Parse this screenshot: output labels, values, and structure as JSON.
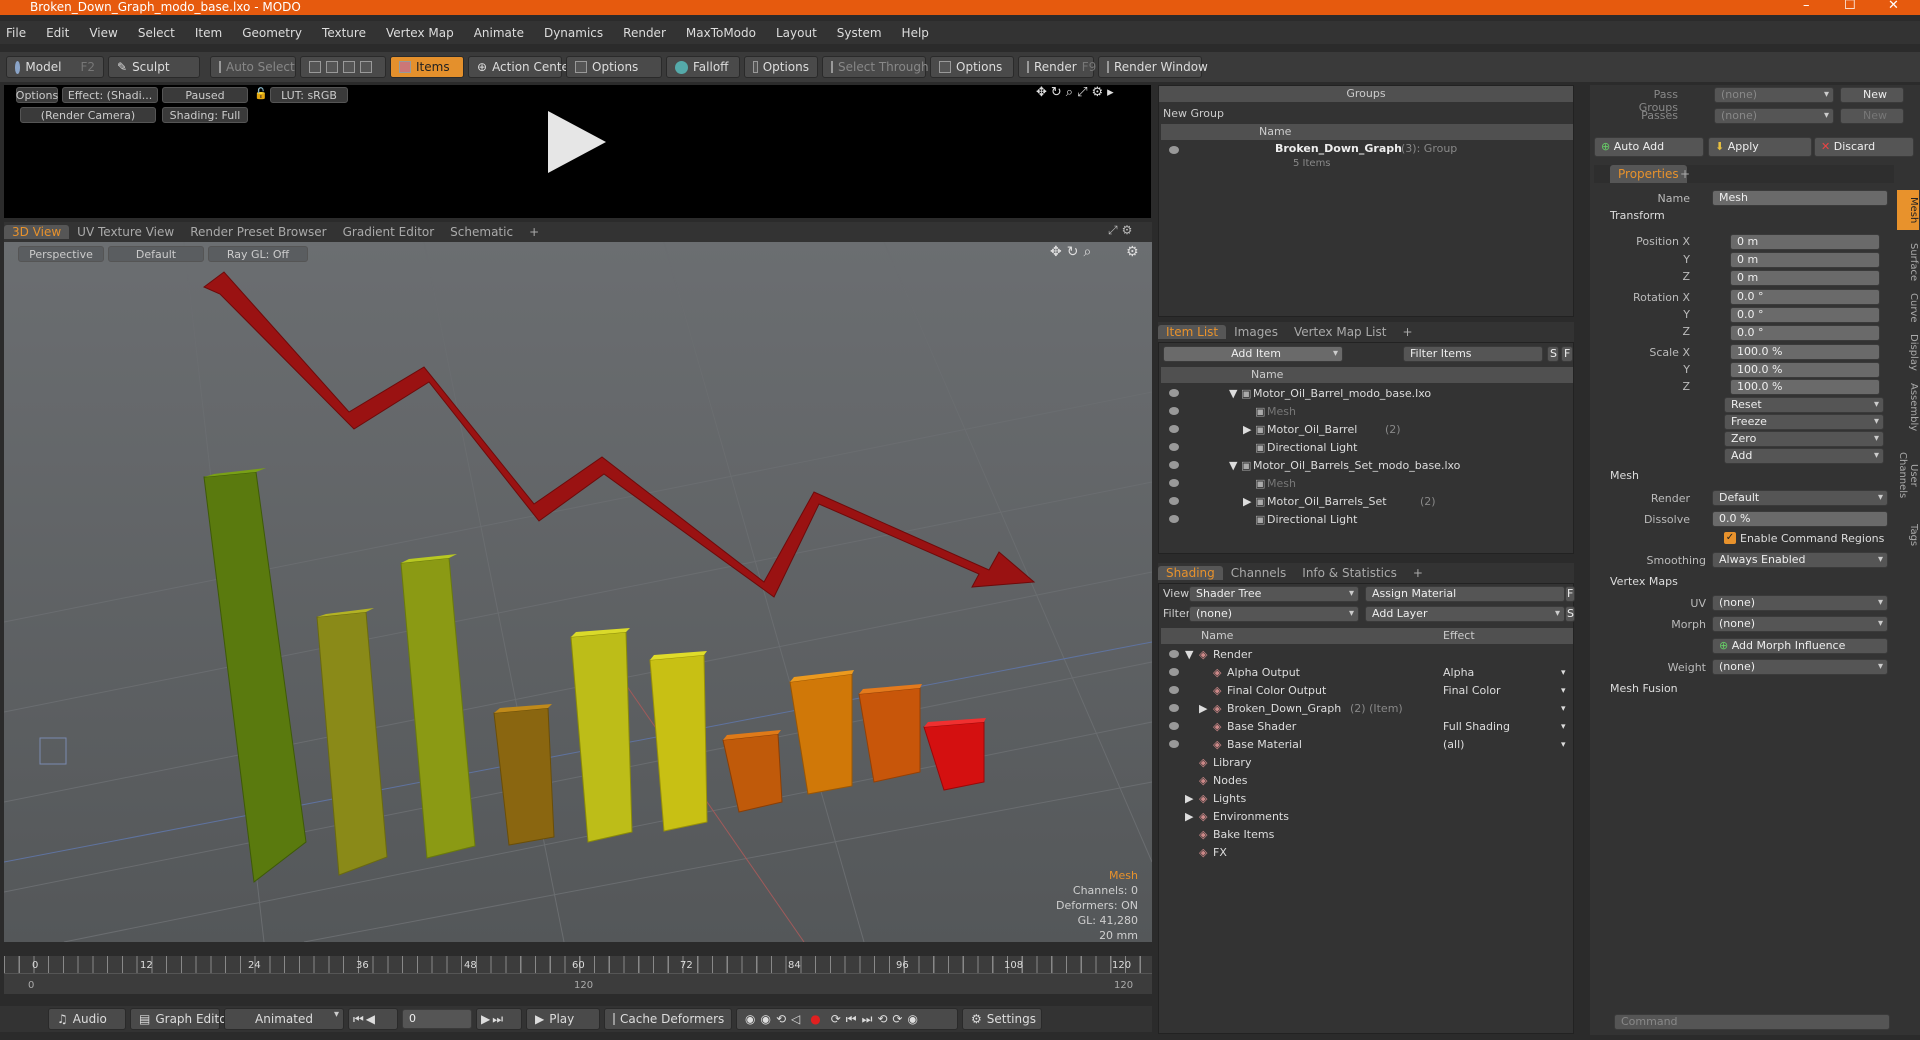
{
  "window": {
    "title": "Broken_Down_Graph_modo_base.lxo - MODO"
  },
  "menu": [
    "File",
    "Edit",
    "View",
    "Select",
    "Item",
    "Geometry",
    "Texture",
    "Vertex Map",
    "Animate",
    "Dynamics",
    "Render",
    "MaxToModo",
    "Layout",
    "System",
    "Help"
  ],
  "toolbar": {
    "model": "Model",
    "model_key": "F2",
    "sculpt": "Sculpt",
    "auto_select": "Auto Select",
    "items": "Items",
    "action_center": "Action Center",
    "options1": "Options",
    "falloff": "Falloff",
    "options2": "Options",
    "select_through": "Select Through",
    "options3": "Options",
    "render": "Render",
    "render_key": "F9",
    "render_window": "Render Window"
  },
  "preview": {
    "options": "Options",
    "effect": "Effect: (Shadi...",
    "paused": "Paused",
    "lut": "LUT: sRGB",
    "camera": "(Render Camera)",
    "shading": "Shading: Full"
  },
  "viewtabs": [
    "3D View",
    "UV Texture View",
    "Render Preset Browser",
    "Gradient Editor",
    "Schematic",
    "+"
  ],
  "viewport": {
    "perspective": "Perspective",
    "default": "Default",
    "raygl": "Ray GL: Off",
    "info": {
      "type": "Mesh",
      "channels": "Channels: 0",
      "deformers": "Deformers: ON",
      "gl": "GL: 41,280",
      "size": "20 mm"
    }
  },
  "timeline": {
    "ticks_top": [
      "0",
      "12",
      "24",
      "36",
      "48",
      "60",
      "72",
      "84",
      "96",
      "108",
      "120"
    ],
    "ticks_bottom": [
      "0",
      "120",
      "120"
    ]
  },
  "bottombar": {
    "audio": "Audio",
    "graph_editor": "Graph Editor",
    "animated": "Animated",
    "frame": "0",
    "play": "Play",
    "cache": "Cache Deformers",
    "settings": "Settings"
  },
  "groups": {
    "title": "Groups",
    "new_group": "New Group",
    "col_name": "Name",
    "group_name": "Broken_Down_Graph",
    "group_count": "(3)",
    "group_type": ": Group",
    "group_items": "5 Items"
  },
  "itemlist": {
    "tabs": [
      "Item List",
      "Images",
      "Vertex Map List",
      "+"
    ],
    "add_item": "Add Item",
    "filter": "Filter Items",
    "s": "S",
    "f": "F",
    "col_name": "Name",
    "rows": [
      {
        "label": "Motor_Oil_Barrel_modo_base.lxo",
        "indent": 0,
        "exp": "▼",
        "dim": false,
        "count": ""
      },
      {
        "label": "Mesh",
        "indent": 1,
        "exp": "",
        "dim": true,
        "count": ""
      },
      {
        "label": "Motor_Oil_Barrel",
        "indent": 1,
        "exp": "▶",
        "dim": false,
        "count": "(2)"
      },
      {
        "label": "Directional Light",
        "indent": 1,
        "exp": "",
        "dim": false,
        "count": ""
      },
      {
        "label": "Motor_Oil_Barrels_Set_modo_base.lxo",
        "indent": 0,
        "exp": "▼",
        "dim": false,
        "count": ""
      },
      {
        "label": "Mesh",
        "indent": 1,
        "exp": "",
        "dim": true,
        "count": ""
      },
      {
        "label": "Motor_Oil_Barrels_Set",
        "indent": 1,
        "exp": "▶",
        "dim": false,
        "count": "(2)"
      },
      {
        "label": "Directional Light",
        "indent": 1,
        "exp": "",
        "dim": false,
        "count": ""
      }
    ]
  },
  "shading": {
    "tabs": [
      "Shading",
      "Channels",
      "Info & Statistics",
      "+"
    ],
    "view_label": "View",
    "view_value": "Shader Tree",
    "assign_material": "Assign Material",
    "filter_label": "Filter",
    "filter_value": "(none)",
    "add_layer": "Add Layer",
    "f": "F",
    "s": "S",
    "col_name": "Name",
    "col_effect": "Effect",
    "rows": [
      {
        "label": "Render",
        "effect": "",
        "indent": 0,
        "exp": "▼"
      },
      {
        "label": "Alpha Output",
        "effect": "Alpha",
        "indent": 1,
        "exp": ""
      },
      {
        "label": "Final Color Output",
        "effect": "Final Color",
        "indent": 1,
        "exp": ""
      },
      {
        "label": "Broken_Down_Graph",
        "effect": "",
        "indent": 1,
        "exp": "▶",
        "suffix": "(2) (Item)"
      },
      {
        "label": "Base Shader",
        "effect": "Full Shading",
        "indent": 1,
        "exp": ""
      },
      {
        "label": "Base Material",
        "effect": "(all)",
        "indent": 1,
        "exp": ""
      },
      {
        "label": "Library",
        "effect": "",
        "indent": 0,
        "exp": ""
      },
      {
        "label": "Nodes",
        "effect": "",
        "indent": 0,
        "exp": ""
      },
      {
        "label": "Lights",
        "effect": "",
        "indent": 0,
        "exp": "▶"
      },
      {
        "label": "Environments",
        "effect": "",
        "indent": 0,
        "exp": "▶"
      },
      {
        "label": "Bake Items",
        "effect": "",
        "indent": 0,
        "exp": ""
      },
      {
        "label": "FX",
        "effect": "",
        "indent": 0,
        "exp": ""
      }
    ]
  },
  "passbar": {
    "pass_groups": "Pass Groups",
    "passes": "Passes",
    "none1": "(none)",
    "none2": "(none)",
    "new1": "New",
    "new2": "New",
    "auto_add": "Auto Add",
    "apply": "Apply",
    "discard": "Discard"
  },
  "properties": {
    "tab": "Properties",
    "plus": "+",
    "name_label": "Name",
    "name_value": "Mesh",
    "transform": "Transform",
    "pos_label": "Position X",
    "y": "Y",
    "z": "Z",
    "pos": [
      "0 m",
      "0 m",
      "0 m"
    ],
    "rot_label": "Rotation X",
    "rot": [
      "0.0 °",
      "0.0 °",
      "0.0 °"
    ],
    "scale_label": "Scale X",
    "scale": [
      "100.0 %",
      "100.0 %",
      "100.0 %"
    ],
    "actions": [
      "Reset",
      "Freeze",
      "Zero",
      "Add"
    ],
    "mesh": "Mesh",
    "render_label": "Render",
    "render_value": "Default",
    "dissolve_label": "Dissolve",
    "dissolve_value": "0.0 %",
    "enable_cmd": "Enable Command Regions",
    "smoothing_label": "Smoothing",
    "smoothing_value": "Always Enabled",
    "vertex_maps": "Vertex Maps",
    "uv_label": "UV",
    "uv_value": "(none)",
    "morph_label": "Morph",
    "morph_value": "(none)",
    "add_morph": "Add Morph Influence",
    "weight_label": "Weight",
    "weight_value": "(none)",
    "mesh_fusion": "Mesh Fusion",
    "sidetabs": [
      "Mesh",
      "Surface",
      "Curve",
      "Display",
      "Assembly",
      "User Channels",
      "Tags"
    ]
  },
  "command": {
    "placeholder": "Command"
  },
  "colors": {
    "accent": "#e65a0e",
    "orange": "#e8922c"
  }
}
